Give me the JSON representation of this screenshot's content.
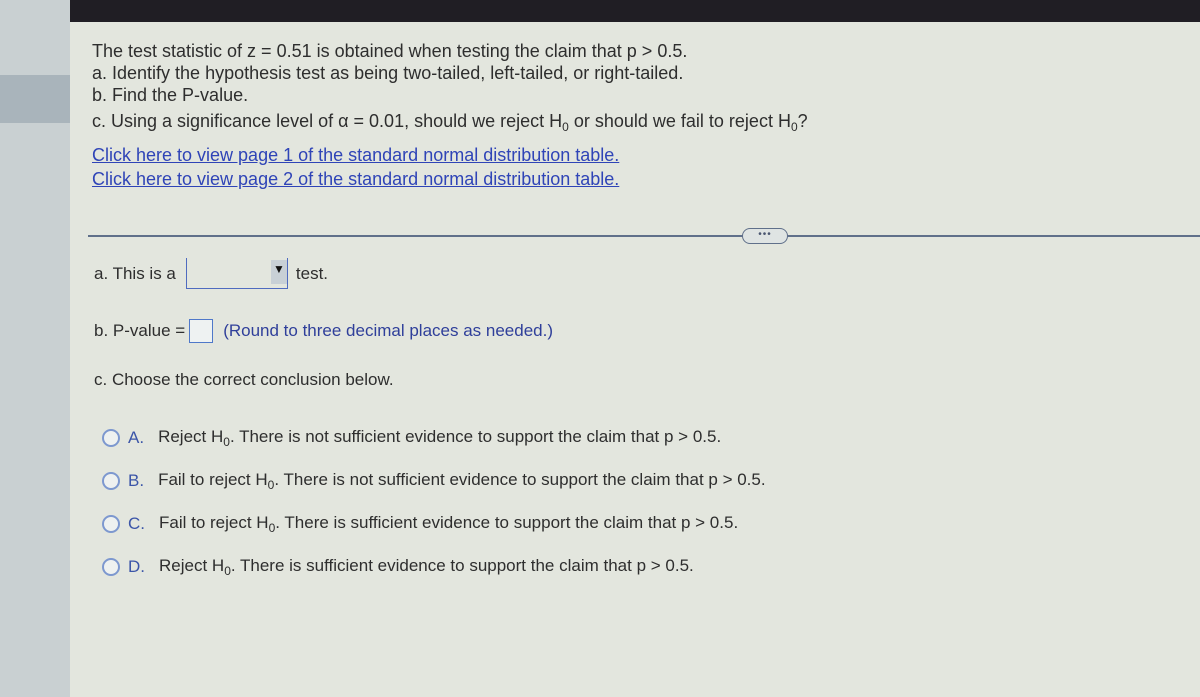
{
  "question": {
    "statement_prefix": "The test statistic of z = 0.51 is obtained when testing the claim that p > 0.5.",
    "part_a": "a. Identify the hypothesis test as being two-tailed, left-tailed, or right-tailed.",
    "part_b": "b. Find the P-value.",
    "part_c_pre": "c. Using a significance level of α = 0.01, should we reject H",
    "part_c_mid": " or should we fail to reject H",
    "part_c_end": "?",
    "subscript": "0",
    "link1": "Click here to view page 1 of the standard normal distribution table.",
    "link2": "Click here to view page 2 of the standard normal distribution table."
  },
  "more_button": "•••",
  "answers": {
    "a_prefix": "a. This is a",
    "a_dropdown_value": "",
    "a_dropdown_arrow": "▼",
    "a_suffix": "test.",
    "b_prefix": "b. P-value =",
    "b_value": "",
    "b_hint": "(Round to three decimal places as needed.)",
    "c_prompt": "c. Choose the correct conclusion below."
  },
  "options": [
    {
      "letter": "A.",
      "pre": "Reject H",
      "sub": "0",
      "post": ". There is not sufficient evidence to support the claim that p > 0.5."
    },
    {
      "letter": "B.",
      "pre": "Fail to reject H",
      "sub": "0",
      "post": ". There is not sufficient evidence to support the claim that p > 0.5."
    },
    {
      "letter": "C.",
      "pre": "Fail to reject H",
      "sub": "0",
      "post": ". There is sufficient evidence to support the claim that p > 0.5."
    },
    {
      "letter": "D.",
      "pre": "Reject H",
      "sub": "0",
      "post": ". There is sufficient evidence to support the claim that p > 0.5."
    }
  ]
}
